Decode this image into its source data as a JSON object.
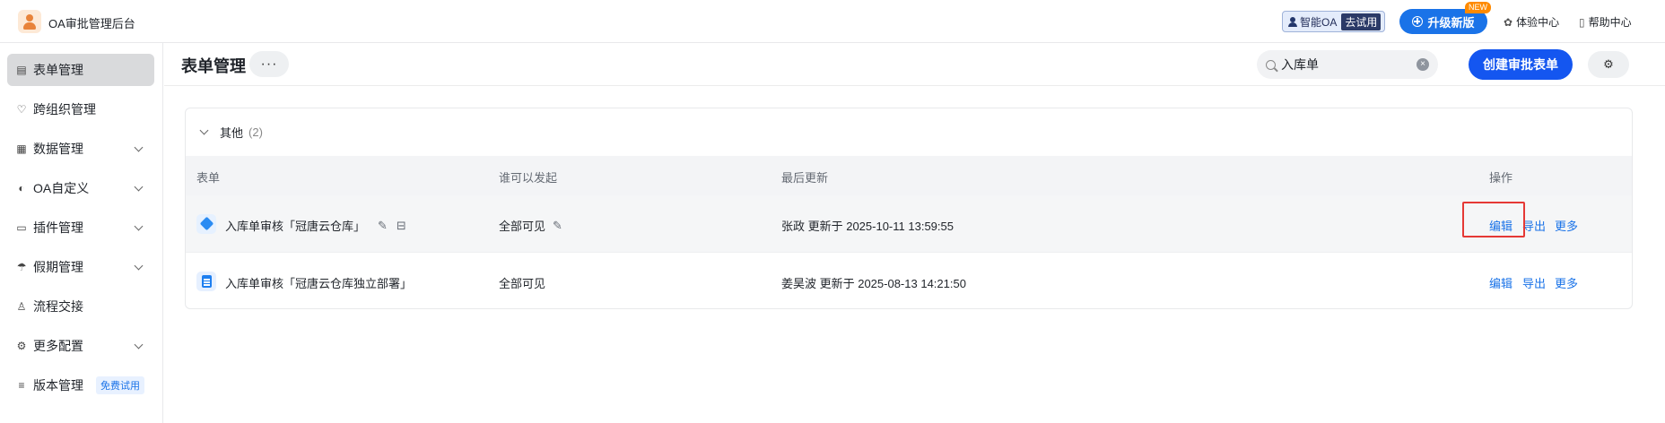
{
  "app": {
    "title": "OA审批管理后台"
  },
  "topbar": {
    "smart_oa_label": "智能OA",
    "smart_oa_trial": "去试用",
    "upgrade_label": "升级新版",
    "new_badge": "NEW",
    "experience_center": "体验中心",
    "help_center": "帮助中心"
  },
  "sidebar": {
    "items": [
      {
        "label": "表单管理",
        "icon": "form-icon",
        "active": true
      },
      {
        "label": "跨组织管理",
        "icon": "heart-link-icon"
      },
      {
        "label": "数据管理",
        "icon": "table-icon",
        "expandable": true
      },
      {
        "label": "OA自定义",
        "icon": "palette-icon",
        "expandable": true
      },
      {
        "label": "插件管理",
        "icon": "plugin-icon",
        "expandable": true
      },
      {
        "label": "假期管理",
        "icon": "umbrella-icon",
        "expandable": true
      },
      {
        "label": "流程交接",
        "icon": "user-handover-icon"
      },
      {
        "label": "更多配置",
        "icon": "gear-icon",
        "expandable": true
      },
      {
        "label": "版本管理",
        "icon": "sliders-icon",
        "badge": "免费试用"
      }
    ]
  },
  "header": {
    "title": "表单管理",
    "more_label": "···",
    "search_value": "入库单",
    "create_label": "创建审批表单"
  },
  "group": {
    "name": "其他",
    "count": "(2)"
  },
  "table": {
    "columns": [
      "表单",
      "谁可以发起",
      "最后更新",
      "操作"
    ],
    "rows": [
      {
        "name": "入库单审核「冠唐云仓库」",
        "visibility": "全部可见",
        "updated": "张政 更新于 2025-10-11 13:59:55",
        "actions": [
          "编辑",
          "导出",
          "更多"
        ]
      },
      {
        "name": "入库单审核「冠唐云仓库独立部署」",
        "visibility": "全部可见",
        "updated": "姜昊波 更新于 2025-08-13 14:21:50",
        "actions": [
          "编辑",
          "导出",
          "更多"
        ]
      }
    ]
  },
  "colors": {
    "primary": "#1456f0",
    "link": "#1a73e8",
    "highlight": "#e53935"
  }
}
